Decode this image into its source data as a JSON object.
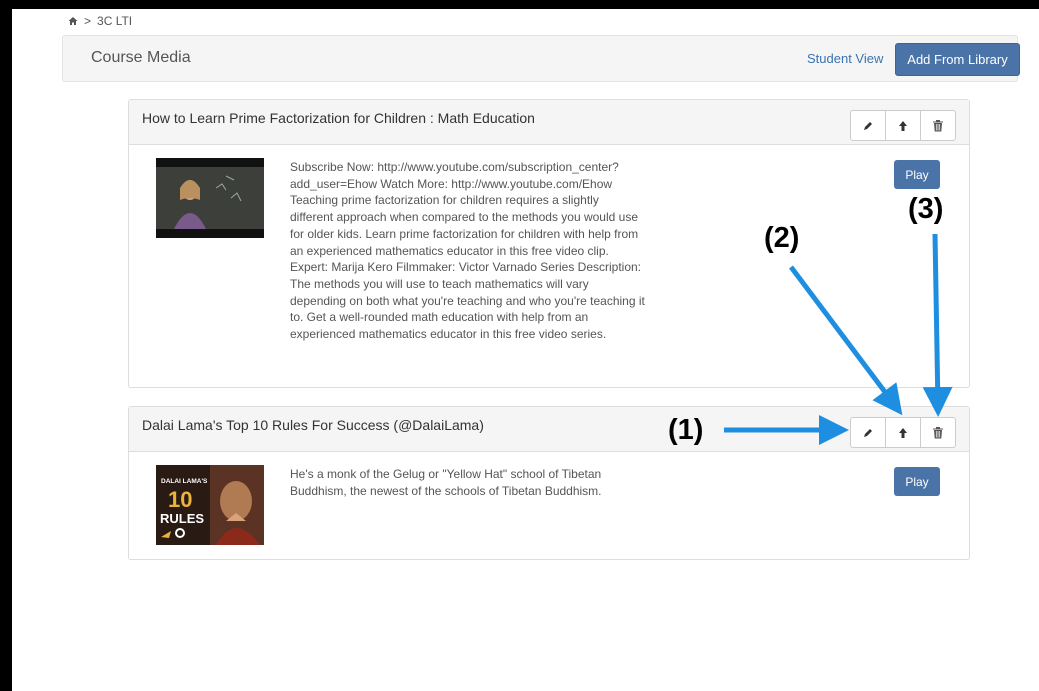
{
  "breadcrumb": {
    "home_icon": "home-icon",
    "separator": ">",
    "current": "3C LTI"
  },
  "header": {
    "title": "Course Media",
    "student_view": "Student View",
    "add_from_library": "Add From Library"
  },
  "media": [
    {
      "title": "How to Learn Prime Factorization for Children : Math Education",
      "description": [
        "Subscribe Now: http://www.youtube.com/subscription_center?",
        "add_user=Ehow Watch More: http://www.youtube.com/Ehow",
        "Teaching prime factorization for children requires a slightly",
        "different approach when compared to the methods you would use",
        "for older kids. Learn prime factorization for children with help from",
        "an experienced mathematics educator in this free video clip.",
        "Expert: Marija Kero Filmmaker: Victor Varnado Series Description:",
        "The methods you will use to teach mathematics will vary",
        "depending on both what you're teaching and who you're teaching it",
        "to. Get a well-rounded math education with help from an",
        "experienced mathematics educator in this free video series."
      ],
      "play": "Play"
    },
    {
      "title": "Dalai Lama's Top 10 Rules For Success (@DalaiLama)",
      "description": [
        "He's a monk of the Gelug or \"Yellow Hat\" school of Tibetan",
        "Buddhism, the newest of the schools of Tibetan Buddhism."
      ],
      "play": "Play",
      "thumb_text": {
        "top": "DALAI LAMA'S",
        "number": "10",
        "word": "RULES"
      }
    }
  ],
  "annotations": {
    "one": "(1)",
    "two": "(2)",
    "three": "(3)"
  },
  "icons": {
    "edit": "pencil-icon",
    "move": "arrow-up-icon",
    "delete": "trash-icon"
  },
  "colors": {
    "primary": "#4a73a8",
    "link": "#3b73af",
    "arrow": "#1e8fe0"
  }
}
